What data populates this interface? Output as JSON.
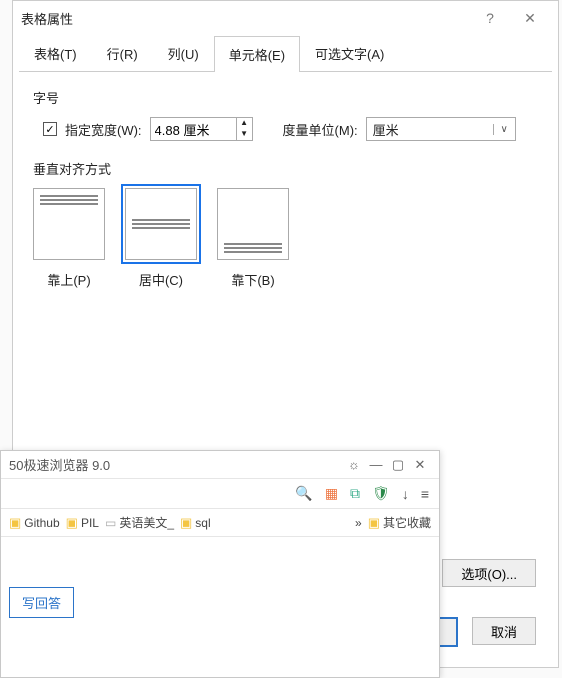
{
  "dialog": {
    "title": "表格属性",
    "help": "?",
    "close": "✕",
    "tabs": {
      "table": "表格(T)",
      "row": "行(R)",
      "col": "列(U)",
      "cell": "单元格(E)",
      "alt": "可选文字(A)"
    },
    "size_label": "字号",
    "specify_width": "指定宽度(W):",
    "width_value": "4.88 厘米",
    "unit_label": "度量单位(M):",
    "unit_value": "厘米",
    "valign_label": "垂直对齐方式",
    "valign": {
      "top": "靠上(P)",
      "center": "居中(C)",
      "bottom": "靠下(B)"
    },
    "options": "选项(O)...",
    "cancel": "取消"
  },
  "browser": {
    "title": "50极速浏览器 9.0",
    "bookmarks": {
      "github": "Github",
      "pil": "PIL",
      "english": "英语美文_",
      "sql": "sql",
      "other": "其它收藏"
    },
    "answer_btn": "写回答"
  }
}
